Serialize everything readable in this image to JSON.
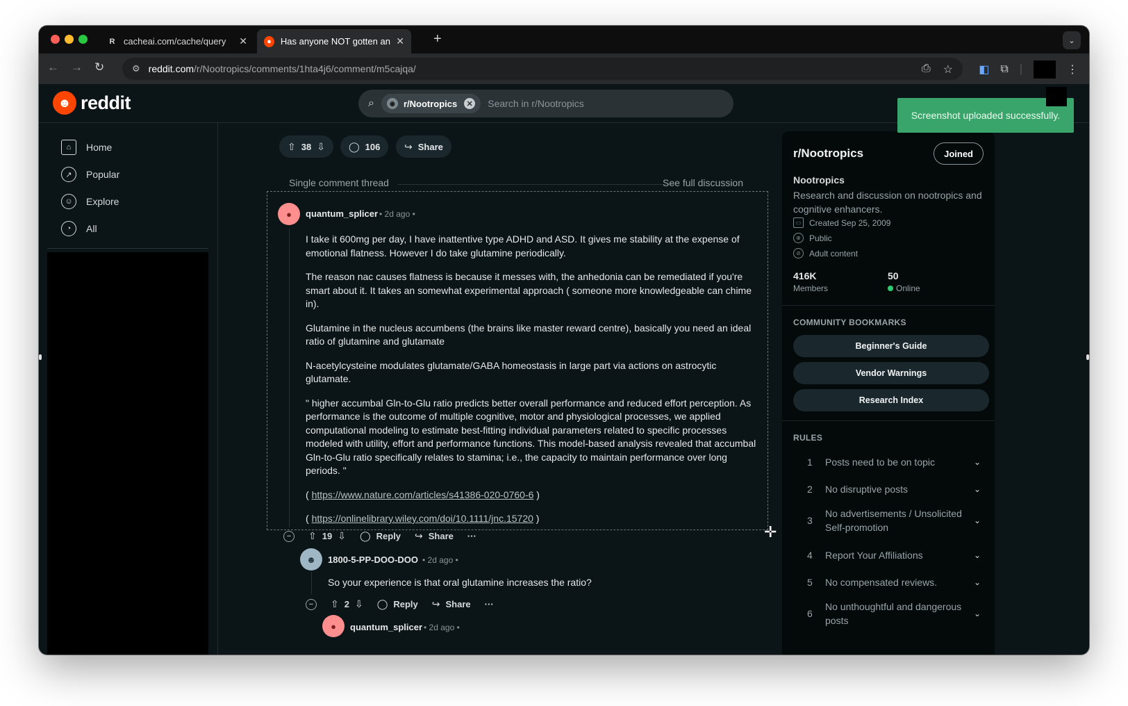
{
  "browser": {
    "tabs": [
      {
        "favicon": "R",
        "title": "cacheai.com/cache/query",
        "active": false
      },
      {
        "favicon": "reddit-icon",
        "title": "Has anyone NOT gotten anhe",
        "active": true
      }
    ],
    "url_host": "reddit.com",
    "url_path": "/r/Nootropics/comments/1hta4j6/comment/m5cajqa/"
  },
  "header": {
    "logo_text": "reddit",
    "search_chip": "r/Nootropics",
    "search_placeholder": "Search in r/Nootropics",
    "toast": "Screenshot uploaded successfully."
  },
  "sidebar": {
    "items": [
      {
        "label": "Home",
        "icon": "home-icon"
      },
      {
        "label": "Popular",
        "icon": "popular-icon"
      },
      {
        "label": "Explore",
        "icon": "explore-icon"
      },
      {
        "label": "All",
        "icon": "all-icon"
      }
    ]
  },
  "post_bar": {
    "votes": "38",
    "comments": "106",
    "share": "Share"
  },
  "thread": {
    "label": "Single comment thread",
    "see_full": "See full discussion"
  },
  "comment": {
    "author": "quantum_splicer",
    "time": "2d ago",
    "paragraphs": [
      "I take it 600mg per day, I have inattentive type ADHD and ASD. It gives me stability at the expense of emotional flatness. However I do take glutamine periodically.",
      "The reason nac causes flatness is because it messes with, the anhedonia can be remediated if you're smart about it. It takes an somewhat experimental approach ( someone more knowledgeable can chime in).",
      "Glutamine in the nucleus accumbens (the brains like master reward centre), basically you need an ideal ratio of glutamine and glutamate",
      "N-acetylcysteine modulates glutamate/GABA homeostasis in large part via actions on astrocytic glutamate.",
      "\" higher accumbal Gln-to-Glu ratio predicts better overall performance and reduced effort perception. As performance is the outcome of multiple cognitive, motor and physiological processes, we applied computational modeling to estimate best-fitting individual parameters related to specific processes modeled with utility, effort and performance functions. This model-based analysis revealed that accumbal Gln-to-Glu ratio specifically relates to stamina; i.e., the capacity to maintain performance over long periods. \""
    ],
    "link1": "https://www.nature.com/articles/s41386-020-0760-6",
    "link2": "https://onlinelibrary.wiley.com/doi/10.1111/jnc.15720",
    "paren_open": "(",
    "paren_close": ")",
    "votes": "19",
    "reply": "Reply",
    "share": "Share",
    "more": "···"
  },
  "reply1": {
    "author": "1800-5-PP-DOO-DOO",
    "time": "2d ago",
    "text": "So your experience is that oral glutamine increases the ratio?",
    "votes": "2",
    "reply": "Reply",
    "share": "Share",
    "more": "···"
  },
  "reply2": {
    "author": "quantum_splicer",
    "time": "2d ago"
  },
  "community": {
    "title": "r/Nootropics",
    "joined": "Joined",
    "name": "Nootropics",
    "description": "Research and discussion on nootropics and cognitive enhancers.",
    "created": "Created Sep 25, 2009",
    "visibility": "Public",
    "content": "Adult content",
    "members_num": "416K",
    "members_label": "Members",
    "online_num": "50",
    "online_label": "Online",
    "bookmarks_title": "COMMUNITY BOOKMARKS",
    "bookmarks": [
      "Beginner's Guide",
      "Vendor Warnings",
      "Research Index"
    ],
    "rules_title": "RULES",
    "rules": [
      {
        "n": "1",
        "text": "Posts need to be on topic"
      },
      {
        "n": "2",
        "text": "No disruptive posts"
      },
      {
        "n": "3",
        "text": "No advertisements / Unsolicited Self-promotion"
      },
      {
        "n": "4",
        "text": "Report Your Affiliations"
      },
      {
        "n": "5",
        "text": "No compensated reviews."
      },
      {
        "n": "6",
        "text": "No unthoughtful and dangerous posts"
      }
    ]
  },
  "colors": {
    "accent": "#ff4500",
    "background": "#0b1416",
    "toast": "#3aa56b"
  }
}
